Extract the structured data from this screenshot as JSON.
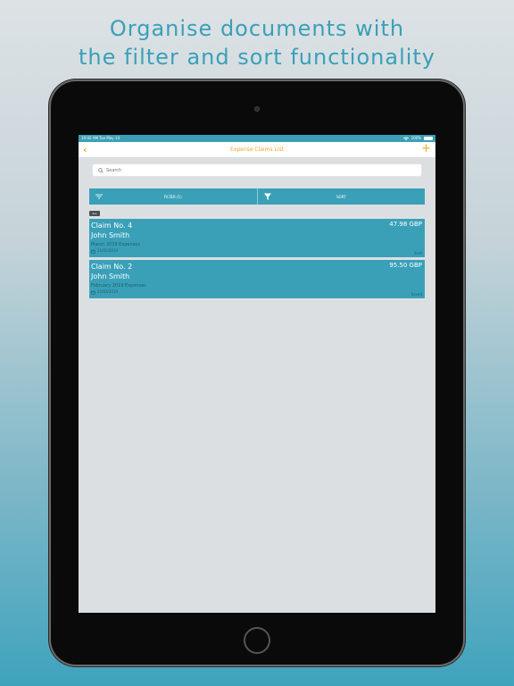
{
  "headline": {
    "line1": "Organise documents with",
    "line2": "the filter and sort functionality"
  },
  "statusbar": {
    "time": "10:02 AM",
    "date": "Tue May 14",
    "battery": "100%"
  },
  "navbar": {
    "back_glyph": "‹",
    "title": "Expense Claims List",
    "add_glyph": "+"
  },
  "search": {
    "placeholder": "Search"
  },
  "filterbar": {
    "filter_label": "FILTER (1)",
    "sort_label": "SORT"
  },
  "tag": {
    "label": "ALL"
  },
  "claims": [
    {
      "title": "Claim No. 4",
      "name": "John Smith",
      "description": "March 2019 Expenses",
      "date": "15/03/2019",
      "amount": "47.98 GBP",
      "status": "Sent"
    },
    {
      "title": "Claim No. 2",
      "name": "John Smith",
      "description": "February 2019 Expenses",
      "date": "15/03/2019",
      "amount": "95.50 GBP",
      "status": "Saved"
    }
  ],
  "colors": {
    "accent": "#3aa0b8",
    "nav_tint": "#f5a623",
    "screen_bg": "#dcdfe2"
  },
  "icons": {
    "back": "chevron-left-icon",
    "add": "plus-icon",
    "search": "search-icon",
    "filter": "filter-lines-icon",
    "sort": "funnel-icon",
    "date": "calendar-icon"
  }
}
